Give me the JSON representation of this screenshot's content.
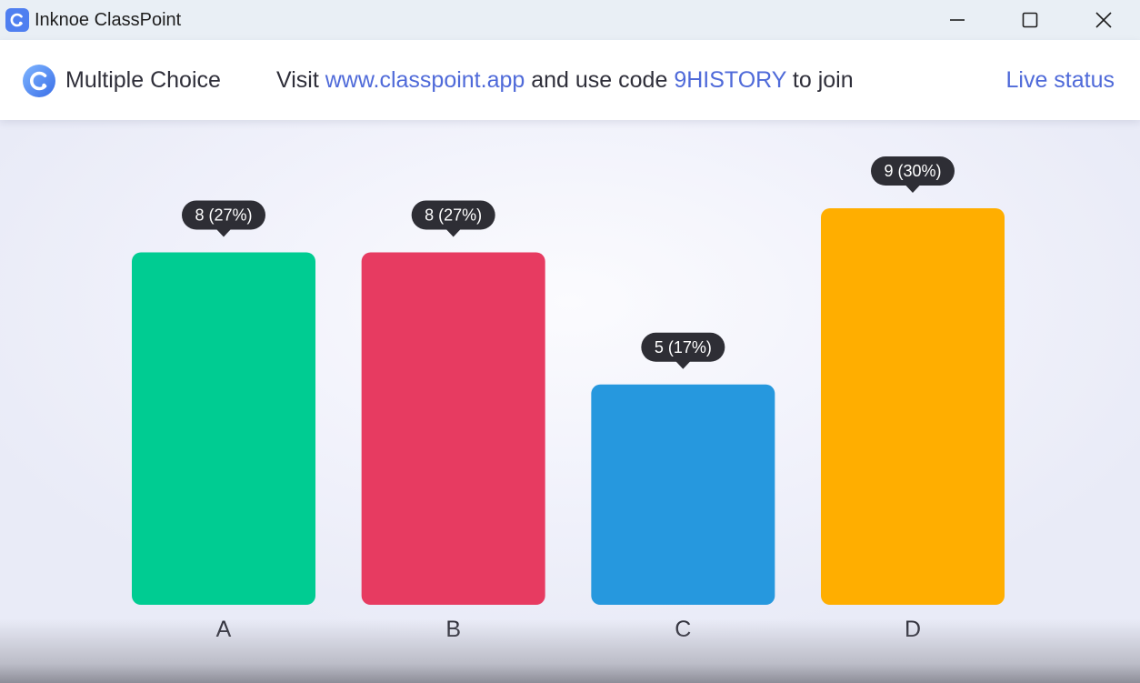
{
  "window": {
    "title": "Inknoe ClassPoint",
    "logo_icon": "classpoint-logo-icon"
  },
  "header": {
    "activity_title": "Multiple Choice",
    "join_prefix": "Visit ",
    "join_url": "www.classpoint.app",
    "join_middle": " and use code ",
    "join_code": "9HISTORY",
    "join_suffix": " to join",
    "live_status_label": "Live status"
  },
  "colors": {
    "accent": "#4f6ad9",
    "label_bubble": "#2e2e35"
  },
  "chart_data": {
    "type": "bar",
    "categories": [
      "A",
      "B",
      "C",
      "D"
    ],
    "values": [
      8,
      8,
      5,
      9
    ],
    "data_labels": [
      "8 (27%)",
      "8 (27%)",
      "5 (17%)",
      "9 (30%)"
    ],
    "colors": [
      "#00cc92",
      "#e73b61",
      "#2698de",
      "#ffae00"
    ],
    "ylim": [
      0,
      9
    ],
    "grid": false,
    "legend": "none",
    "title": "",
    "xlabel": "",
    "ylabel": ""
  }
}
